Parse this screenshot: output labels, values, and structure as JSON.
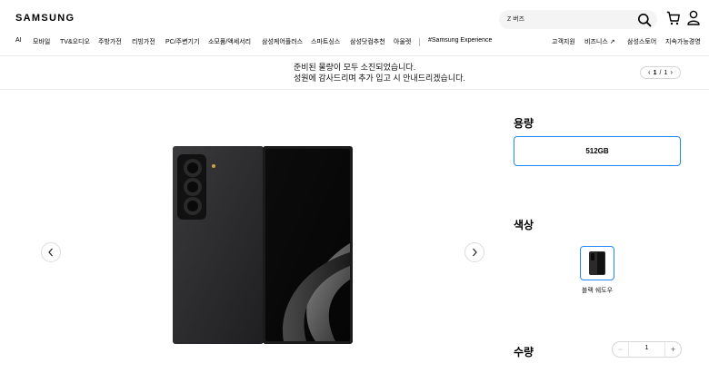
{
  "header": {
    "logo": "SAMSUNG",
    "search": {
      "value": "Z 버즈"
    },
    "icons": [
      "search-icon",
      "cart-icon",
      "user-icon"
    ]
  },
  "nav": {
    "items": [
      "AI",
      "모바일",
      "TV&오디오",
      "주방가전",
      "리빙가전",
      "PC/주변기기",
      "소모품/액세서리",
      "삼성케어플러스",
      "스마트싱스",
      "삼성닷컴추천",
      "아울렛",
      "#Samsung Experience"
    ],
    "right": [
      "고객지원",
      "비즈니스",
      "삼성스토어",
      "지속가능경영"
    ]
  },
  "notice": {
    "line1": "준비된 물량이 모두 소진되었습니다.",
    "line2": "성원에 감사드리며 추가 입고 시 안내드리겠습니다.",
    "page_current": "1",
    "page_sep": "/",
    "page_total": "1"
  },
  "product": {
    "capacity_title": "용량",
    "capacity_option": "512GB",
    "color_title": "색상",
    "color_option": "블랙 쉐도우",
    "color_hex": "#2b2b2b",
    "quantity_title": "수량",
    "quantity_value": "1",
    "selected_border": "#2189ff"
  }
}
